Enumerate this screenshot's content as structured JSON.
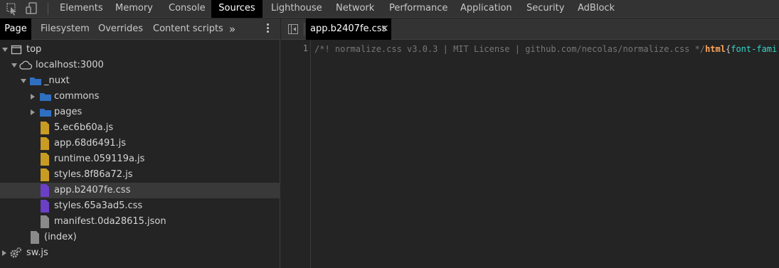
{
  "toolbar": {
    "tabs": [
      "Elements",
      "Memory",
      "Console",
      "Sources",
      "Lighthouse",
      "Network",
      "Performance",
      "Application",
      "Security",
      "AdBlock"
    ],
    "active_tab": "Sources"
  },
  "navigator": {
    "tabs": [
      "Page",
      "Filesystem",
      "Overrides",
      "Content scripts"
    ],
    "active_tab": "Page",
    "more": "»",
    "tree": [
      {
        "label": "top",
        "icon": "frame-icon"
      },
      {
        "label": "localhost:3000",
        "icon": "cloud-icon"
      },
      {
        "label": "_nuxt",
        "icon": "folder-icon"
      },
      {
        "label": "commons",
        "icon": "folder-icon"
      },
      {
        "label": "pages",
        "icon": "folder-icon"
      },
      {
        "label": "5.ec6b60a.js",
        "icon": "js-file-icon"
      },
      {
        "label": "app.68d6491.js",
        "icon": "js-file-icon"
      },
      {
        "label": "runtime.059119a.js",
        "icon": "js-file-icon"
      },
      {
        "label": "styles.8f86a72.js",
        "icon": "js-file-icon"
      },
      {
        "label": "app.b2407fe.css",
        "icon": "css-file-icon"
      },
      {
        "label": "styles.65a3ad5.css",
        "icon": "css-file-icon"
      },
      {
        "label": "manifest.0da28615.json",
        "icon": "file-icon"
      },
      {
        "label": "(index)",
        "icon": "file-icon"
      },
      {
        "label": "sw.js",
        "icon": "gear-icon"
      }
    ],
    "selected": "app.b2407fe.css"
  },
  "editor": {
    "tab_label": "app.b2407fe.css",
    "close_glyph": "×",
    "line_number": "1",
    "code": {
      "comment": "/*! normalize.css v3.0.3 | MIT License | github.com/necolas/normalize.css */",
      "selector": "html",
      "brace": "{",
      "property": "font-fami"
    }
  },
  "colors": {
    "js_file": "#c89b22",
    "css_file": "#6b3fc6",
    "folder": "#2f6fbf",
    "generic_file": "#8a8a8a"
  }
}
